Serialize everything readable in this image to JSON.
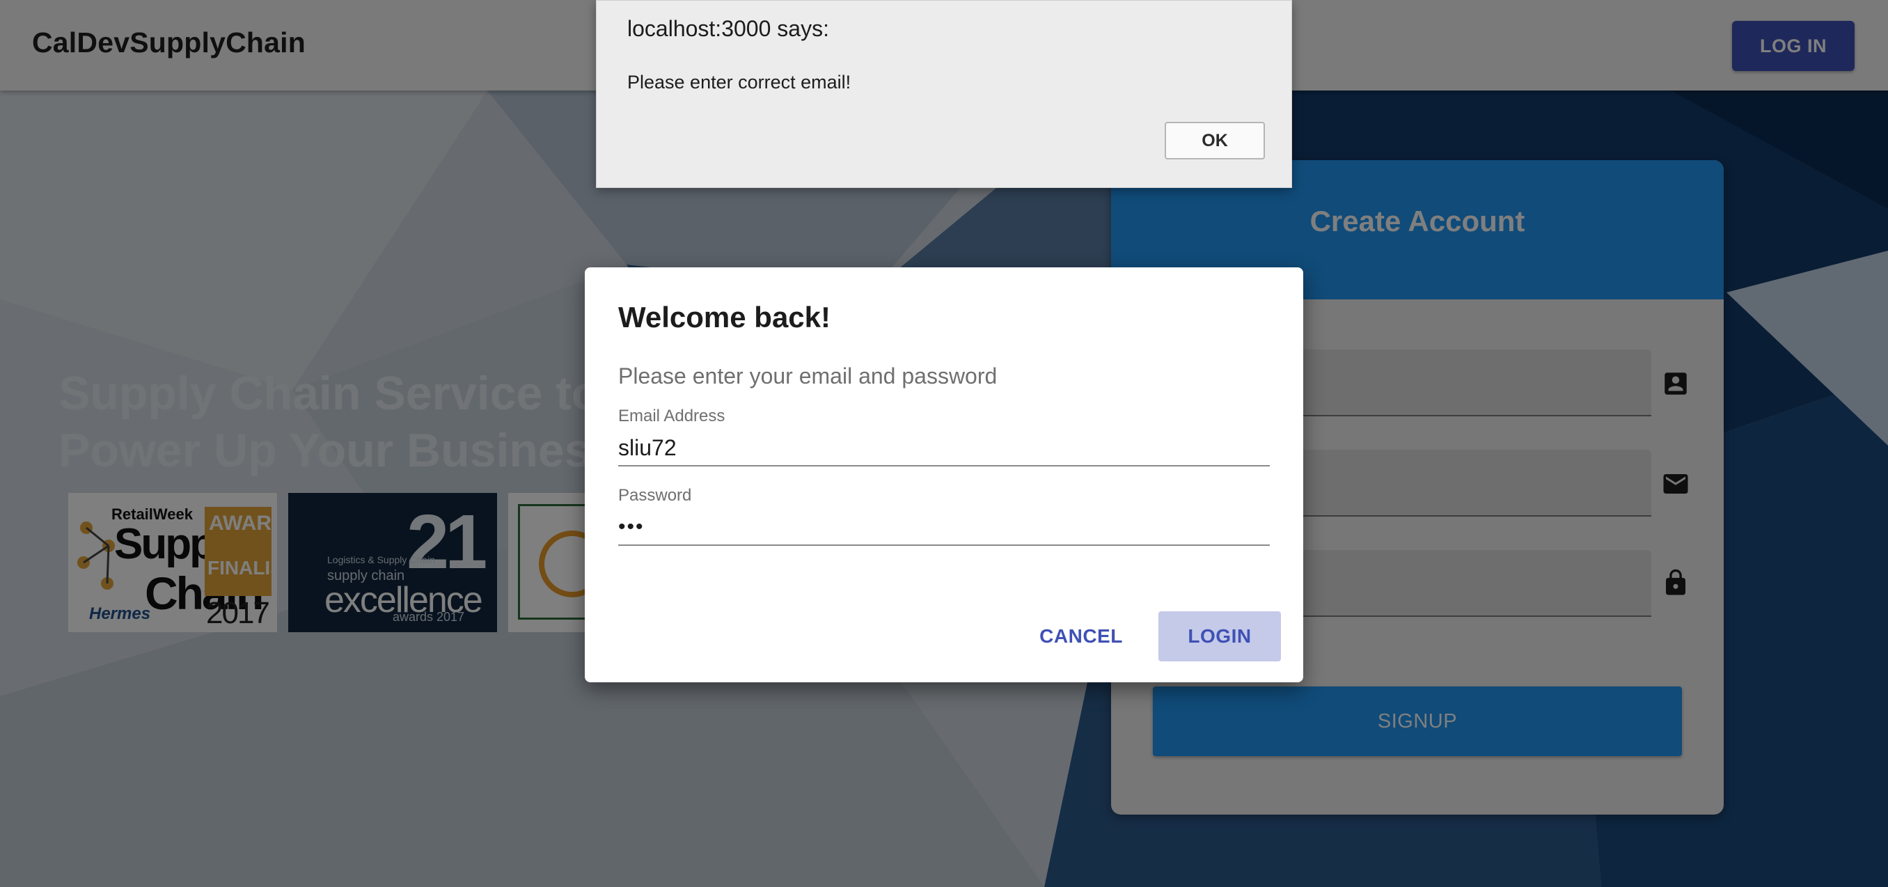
{
  "appbar": {
    "brand": "CalDevSupplyChain",
    "login_label": "LOG IN"
  },
  "hero": {
    "title_line1": "Supply Chain Service to",
    "title_line2": "Power Up Your Business"
  },
  "awards": [
    {
      "retail": "RetailWeek",
      "supply": "Supply",
      "chain": "Chain",
      "hermes": "Hermes",
      "awards": "AWARDS",
      "finalist": "FINALIST",
      "year": "2017"
    },
    {
      "number": "21",
      "small": "Logistics & Supply Chain",
      "small2": "supply chain",
      "excellence": "excellence",
      "awards": "awards 2017"
    }
  ],
  "create_account": {
    "title": "Create Account",
    "signup_label": "SIGNUP",
    "field_icons": [
      "account-box-icon",
      "email-icon",
      "lock-icon"
    ]
  },
  "login_dialog": {
    "title": "Welcome back!",
    "text": "Please enter your email and password",
    "email_label": "Email Address",
    "email_value": "sliu72",
    "password_label": "Password",
    "password_value": "•••",
    "cancel_label": "CANCEL",
    "login_label": "LOGIN"
  },
  "alert": {
    "title": "localhost:3000 says:",
    "message": "Please enter correct email!",
    "ok_label": "OK"
  },
  "colors": {
    "primary": "#3f51b5",
    "accent_blue": "#2196f3",
    "login_disabled_bg": "#c5cae9"
  }
}
